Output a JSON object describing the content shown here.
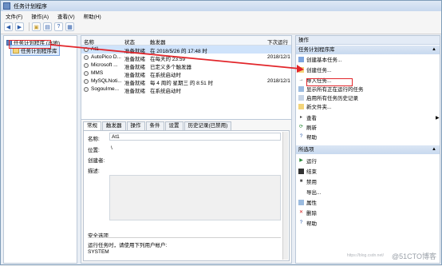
{
  "window": {
    "title": "任务计划程序"
  },
  "menu": [
    "文件(F)",
    "操作(A)",
    "查看(V)",
    "帮助(H)"
  ],
  "tree": {
    "root": "任务计划程序 (本地)",
    "library": "任务计划程序库"
  },
  "table": {
    "headers": [
      "名称",
      "状态",
      "触发器",
      "下次运行时"
    ],
    "rows": [
      {
        "name": "At1",
        "status": "准备就绪",
        "trigger": "在 2018/5/26 的 17:48 时",
        "next": ""
      },
      {
        "name": "AutoPico D...",
        "status": "准备就绪",
        "trigger": "在每天的 23:59",
        "next": "2018/12/1"
      },
      {
        "name": "Microsoft ...",
        "status": "准备就绪",
        "trigger": "已定义多个触发器",
        "next": ""
      },
      {
        "name": "MMS",
        "status": "准备就绪",
        "trigger": "在系统启动时",
        "next": ""
      },
      {
        "name": "MySQLNoti...",
        "status": "准备就绪",
        "trigger": "每 4 周的 星期三 的 8:51 时",
        "next": "2018/12/1"
      },
      {
        "name": "SogouIme...",
        "status": "准备就绪",
        "trigger": "在系统启动时",
        "next": ""
      }
    ]
  },
  "details": {
    "tabs": [
      "常规",
      "触发器",
      "操作",
      "条件",
      "设置",
      "历史记录(已禁用)"
    ],
    "name_label": "名称:",
    "name_value": "At1",
    "location_label": "位置:",
    "location_value": "\\",
    "author_label": "创建者:",
    "desc_label": "描述:",
    "security_label": "安全选项",
    "run_label": "运行任务时，请使用下列用户帐户:",
    "run_value": "SYSTEM"
  },
  "actions": {
    "header": "操作",
    "section1": "任务计划程序库",
    "items1": [
      {
        "label": "创建基本任务...",
        "icon": "wizard-icon"
      },
      {
        "label": "创建任务...",
        "icon": "create-task-icon"
      },
      {
        "label": "导入任务...",
        "icon": "import-icon"
      },
      {
        "label": "显示所有正在运行的任务",
        "icon": "running-tasks-icon"
      },
      {
        "label": "启用所有任务历史记录",
        "icon": "history-icon"
      },
      {
        "label": "新文件夹...",
        "icon": "folder-icon"
      },
      {
        "label": "查看",
        "icon": "view-icon"
      },
      {
        "label": "刷新",
        "icon": "refresh-icon"
      },
      {
        "label": "帮助",
        "icon": "help-icon"
      }
    ],
    "section2": "所选项",
    "items2": [
      {
        "label": "运行",
        "icon": "run-icon"
      },
      {
        "label": "结束",
        "icon": "stop-icon"
      },
      {
        "label": "禁用",
        "icon": "disable-icon"
      },
      {
        "label": "导出...",
        "icon": "export-icon"
      },
      {
        "label": "属性",
        "icon": "properties-icon"
      },
      {
        "label": "删除",
        "icon": "delete-icon"
      },
      {
        "label": "帮助",
        "icon": "help-icon"
      }
    ]
  },
  "watermark": "@51CTO博客",
  "watermark_url": "https://blog.csdn.net/"
}
